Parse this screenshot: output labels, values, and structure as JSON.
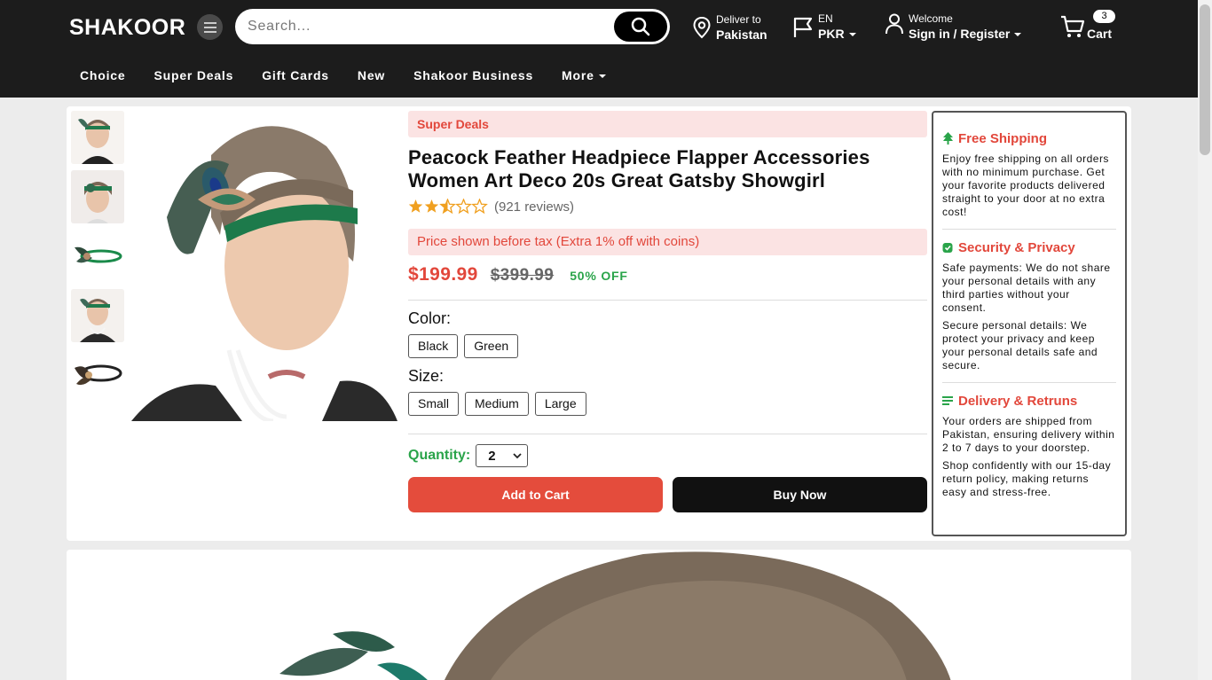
{
  "header": {
    "logo": "SHAKOOR",
    "search_placeholder": "Search...",
    "deliver": {
      "label": "Deliver to",
      "value": "Pakistan"
    },
    "locale": {
      "language": "EN",
      "currency": "PKR"
    },
    "account": {
      "label": "Welcome",
      "value": "Sign in / Register"
    },
    "cart": {
      "label": "Cart",
      "count": "3"
    },
    "nav": [
      "Choice",
      "Super Deals",
      "Gift Cards",
      "New",
      "Shakoor Business",
      "More"
    ]
  },
  "product": {
    "deal_tag": "Super Deals",
    "title": "Peacock Feather Headpiece Flapper Accessories Women Art Deco 20s Great Gatsby Showgirl",
    "rating": 2.5,
    "reviews": "(921 reviews)",
    "tax_note": "Price shown before tax (Extra 1% off with coins)",
    "price": "$199.99",
    "old_price": "$399.99",
    "discount": "50% OFF",
    "color_label": "Color:",
    "colors": [
      "Black",
      "Green"
    ],
    "size_label": "Size:",
    "sizes": [
      "Small",
      "Medium",
      "Large"
    ],
    "quantity_label": "Quantity:",
    "quantity": "2",
    "add_to_cart": "Add to Cart",
    "buy_now": "Buy Now",
    "thumbnails": [
      "model-front",
      "model-side",
      "headband-green",
      "model-pearls",
      "headband-black"
    ]
  },
  "sidebar": {
    "shipping": {
      "title": "Free Shipping",
      "text": "Enjoy free shipping on all orders with no minimum purchase. Get your favorite products delivered straight to your door at no extra cost!"
    },
    "security": {
      "title": "Security & Privacy",
      "text1": "Safe payments: We do not share your personal details with any third parties without your consent.",
      "text2": "Secure personal details: We protect your privacy and keep your personal details safe and secure."
    },
    "delivery": {
      "title": "Delivery & Retruns",
      "text1": "Your orders are shipped from Pakistan, ensuring delivery within 2 to 7 days to your doorstep.",
      "text2": "Shop confidently with our 15-day return policy, making returns easy and stress-free."
    }
  },
  "colors": {
    "accent": "#e2473b",
    "green": "#2aa44a",
    "header_bg": "#1c1c1c",
    "star": "#f0a020"
  }
}
